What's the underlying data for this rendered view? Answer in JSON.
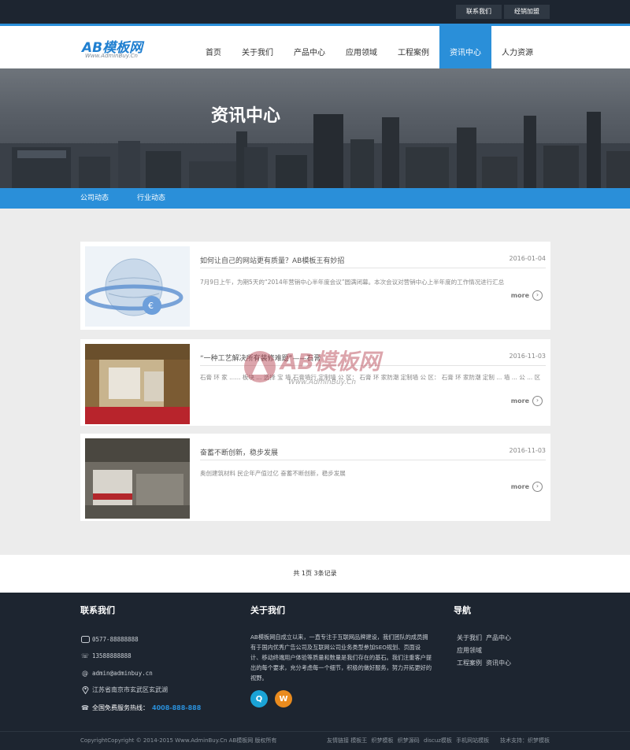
{
  "topbar": {
    "contact_label": "联系我们",
    "dealer_label": "经销加盟"
  },
  "logo": {
    "main": "AB模板网",
    "sub": "Www.AdminBuy.Cn"
  },
  "nav": [
    "首页",
    "关于我们",
    "产品中心",
    "应用领域",
    "工程案例",
    "资讯中心",
    "人力资源"
  ],
  "nav_active_index": 5,
  "banner": {
    "title": "资讯中心"
  },
  "subnav": [
    "公司动态",
    "行业动态"
  ],
  "news": [
    {
      "title": "如何让自己的网站更有质量？AB模板王有妙招",
      "date": "2016-01-04",
      "summary": "7月9日上午，为期5天的“2014年营销中心半年度会议”圆满闭幕。本次会议对营销中心上半年度的工作情况进行汇总",
      "more": "more"
    },
    {
      "title": "“一种工艺解决所有装修难题”——石膏",
      "date": "2016-11-03",
      "summary": "石膏 环 家 ...... 板块 ... 选择 宝 墙 石膏墙行 定制墙 公 区： 石膏 环 家防潮 定制墙 公 区： 石膏 环 家防潮 定制 ... 墙 ... 公 ... 区",
      "more": "more"
    },
    {
      "title": "奋蓄不断创新，稳步发展",
      "date": "2016-11-03",
      "summary": "奥创建筑材料 民企年产值过亿 奋蓄不断创新，稳步发展",
      "more": "more"
    }
  ],
  "watermark": {
    "main": "AB模板网",
    "sub": "Www.AdminBuy.Cn"
  },
  "pager": "共 1页 3条记录",
  "footer": {
    "contact_heading": "联系我们",
    "about_heading": "关于我们",
    "nav_heading": "导航",
    "phone": "0577-88888888",
    "mobile": "13588888888",
    "email": "admin@adminbuy.cn",
    "address": "江苏省南京市玄武区玄武湖",
    "hotline_label": "全国免费服务热线：",
    "hotline_number": "4008-888-888",
    "about_text": "AB模板网自成立以来，一直专注于互联网品牌建设，我们团队的成员拥有于国内优秀广告公司及互联网公司业务类型参加SEO规划、页面设计、移动终端用户体验等质量和数量是我们存在的基石。我们注重客户提出的每个要求，充分考虑每一个细节，积极的做好服务，努力开拓更好的视野。",
    "nav_links": [
      "关于我们",
      "产品中心",
      "应用领域",
      "工程案例",
      "资讯中心"
    ],
    "copyright": "CopyrightCopyright © 2014-2015 Www.AdminBuy.Cn AB模板网 版权所有",
    "bottom_links": [
      "友情链接 模板王",
      "织梦模板",
      "织梦源码",
      "discuz模板",
      "手机网站模板"
    ],
    "support": "技术支持：织梦模板"
  }
}
